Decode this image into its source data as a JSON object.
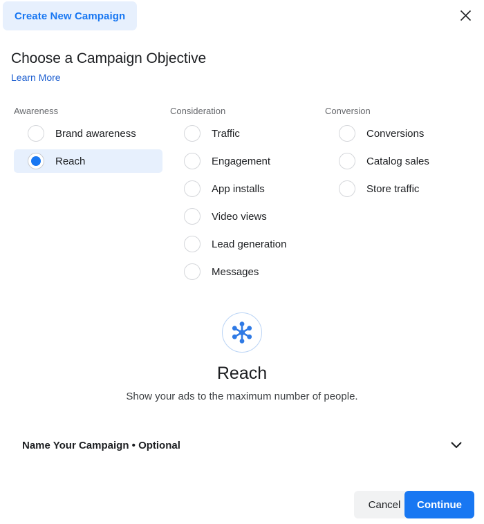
{
  "topbar": {
    "tab_label": "Create New Campaign",
    "close_icon": "close-icon"
  },
  "header": {
    "title": "Choose a Campaign Objective",
    "learn_more": "Learn More"
  },
  "objectives": {
    "awareness": {
      "title": "Awareness",
      "options": [
        {
          "label": "Brand awareness",
          "selected": false
        },
        {
          "label": "Reach",
          "selected": true
        }
      ]
    },
    "consideration": {
      "title": "Consideration",
      "options": [
        {
          "label": "Traffic",
          "selected": false
        },
        {
          "label": "Engagement",
          "selected": false
        },
        {
          "label": "App installs",
          "selected": false
        },
        {
          "label": "Video views",
          "selected": false
        },
        {
          "label": "Lead generation",
          "selected": false
        },
        {
          "label": "Messages",
          "selected": false
        }
      ]
    },
    "conversion": {
      "title": "Conversion",
      "options": [
        {
          "label": "Conversions",
          "selected": false
        },
        {
          "label": "Catalog sales",
          "selected": false
        },
        {
          "label": "Store traffic",
          "selected": false
        }
      ]
    }
  },
  "detail": {
    "icon": "reach-hub-spokes-icon",
    "title": "Reach",
    "description": "Show your ads to the maximum number of people."
  },
  "name_section": {
    "label": "Name Your Campaign • Optional",
    "chevron_icon": "chevron-down-icon"
  },
  "footer": {
    "cancel_label": "Cancel",
    "continue_label": "Continue"
  },
  "colors": {
    "accent": "#1877f2",
    "accent_soft": "#e7f0fd",
    "link": "#1d5fd0",
    "text": "#1c1e21",
    "muted": "#65676b",
    "cancel_bg": "#f1f2f3",
    "radio_border": "#d4d6da"
  }
}
